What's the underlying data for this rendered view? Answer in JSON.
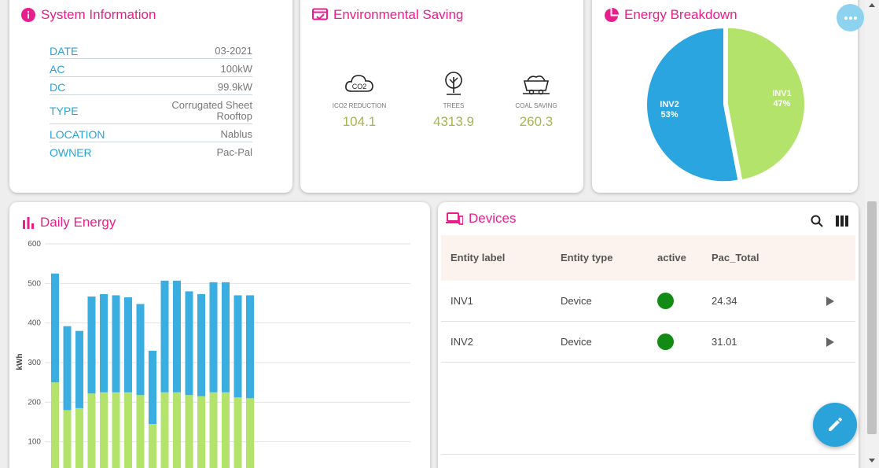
{
  "system_info": {
    "title": "System Information",
    "rows": [
      {
        "key": "DATE",
        "value": "03-2021"
      },
      {
        "key": "AC",
        "value": "100kW"
      },
      {
        "key": "DC",
        "value": "99.9kW"
      },
      {
        "key": "TYPE",
        "value": "Corrugated Sheet Rooftop"
      },
      {
        "key": "LOCATION",
        "value": "Nablus"
      },
      {
        "key": "OWNER",
        "value": "Pac-Pal"
      }
    ]
  },
  "environmental": {
    "title": "Environmental Saving",
    "items": [
      {
        "icon": "co2-cloud-icon",
        "label": "ICO2 REDUCTION",
        "value": "104.1"
      },
      {
        "icon": "tree-icon",
        "label": "TREES",
        "value": "4313.9"
      },
      {
        "icon": "coal-cart-icon",
        "label": "COAL SAVING",
        "value": "260.3"
      }
    ]
  },
  "energy_breakdown": {
    "title": "Energy Breakdown",
    "slices": [
      {
        "name": "INV1",
        "label": "47%",
        "value": 47,
        "color": "#b3e36b"
      },
      {
        "name": "INV2",
        "label": "53%",
        "value": 53,
        "color": "#2aa5df"
      }
    ]
  },
  "daily_energy": {
    "title": "Daily Energy"
  },
  "chart_data": {
    "type": "bar",
    "ylabel": "kWh",
    "ylim": [
      0,
      600
    ],
    "yticks": [
      100,
      200,
      300,
      400,
      500,
      600
    ],
    "series": [
      {
        "name": "",
        "color": "#b3e36b",
        "values": [
          250,
          180,
          185,
          222,
          225,
          225,
          225,
          218,
          145,
          225,
          225,
          218,
          215,
          225,
          225,
          212,
          210
        ]
      },
      {
        "name": "",
        "color": "#3aade1",
        "values": [
          275,
          212,
          195,
          245,
          248,
          245,
          240,
          230,
          185,
          282,
          282,
          262,
          258,
          278,
          278,
          258,
          260
        ]
      }
    ]
  },
  "devices": {
    "title": "Devices",
    "columns": [
      "Entity label",
      "Entity type",
      "active",
      "Pac_Total"
    ],
    "rows": [
      {
        "label": "INV1",
        "type": "Device",
        "active_color": "#138a13",
        "pac_total": "24.34"
      },
      {
        "label": "INV2",
        "type": "Device",
        "active_color": "#138a13",
        "pac_total": "31.01"
      }
    ]
  },
  "colors": {
    "accent": "#e91e8c",
    "key_blue": "#29a3d9",
    "value_green": "#a5b74a",
    "fab_blue": "#29a3d9"
  }
}
